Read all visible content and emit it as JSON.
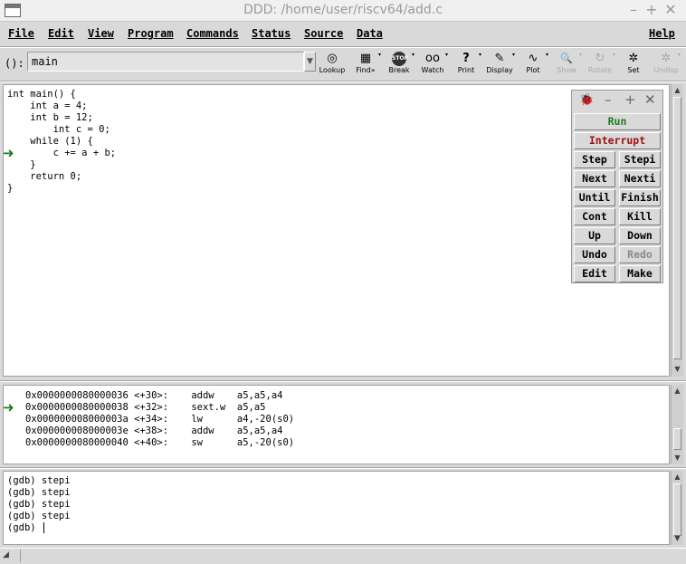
{
  "window": {
    "title": "DDD: /home/user/riscv64/add.c"
  },
  "menu": [
    "File",
    "Edit",
    "View",
    "Program",
    "Commands",
    "Status",
    "Source",
    "Data",
    "Help"
  ],
  "toolbar": {
    "arg_label": "():",
    "arg_value": "main",
    "tools": [
      {
        "label": "Lookup",
        "icon": "lookup-icon",
        "glyph": "◎"
      },
      {
        "label": "Find»",
        "icon": "find-icon",
        "glyph": "▦"
      },
      {
        "label": "Break",
        "icon": "break-icon",
        "glyph": "STOP"
      },
      {
        "label": "Watch",
        "icon": "watch-icon",
        "glyph": "oo"
      },
      {
        "label": "Print",
        "icon": "print-icon",
        "glyph": "?"
      },
      {
        "label": "Display",
        "icon": "display-icon",
        "glyph": "✎"
      },
      {
        "label": "Plot",
        "icon": "plot-icon",
        "glyph": "∿"
      },
      {
        "label": "Show",
        "icon": "show-icon",
        "glyph": "🔍"
      },
      {
        "label": "Rotate",
        "icon": "rotate-icon",
        "glyph": "↻"
      },
      {
        "label": "Set",
        "icon": "set-icon",
        "glyph": "✲"
      },
      {
        "label": "Undisp",
        "icon": "undisp-icon",
        "glyph": "✲"
      }
    ]
  },
  "source": {
    "lines": [
      "int main() {",
      "    int a = 4;",
      "    int b = 12;",
      "        int c = 0;",
      "    while (1) {",
      "        c += a + b;",
      "    }",
      "    return 0;",
      "}"
    ],
    "current_line_index": 5
  },
  "assembly": {
    "lines": [
      "0x0000000080000036 <+30>:    addw    a5,a5,a4",
      "0x0000000080000038 <+32>:    sext.w  a5,a5",
      "0x000000008000003a <+34>:    lw      a4,-20(s0)",
      "0x000000008000003e <+38>:    addw    a5,a5,a4",
      "0x0000000080000040 <+40>:    sw      a5,-20(s0)"
    ],
    "current_line_index": 1
  },
  "console": {
    "lines": [
      "(gdb) stepi",
      "(gdb) stepi",
      "(gdb) stepi",
      "(gdb) stepi",
      "(gdb) "
    ]
  },
  "command_tool": {
    "run": "Run",
    "interrupt": "Interrupt",
    "pairs": [
      [
        "Step",
        "Stepi"
      ],
      [
        "Next",
        "Nexti"
      ],
      [
        "Until",
        "Finish"
      ],
      [
        "Cont",
        "Kill"
      ],
      [
        "Up",
        "Down"
      ],
      [
        "Undo",
        "Redo"
      ],
      [
        "Edit",
        "Make"
      ]
    ],
    "run_color": "#1f7a1f",
    "interrupt_color": "#a01010"
  }
}
